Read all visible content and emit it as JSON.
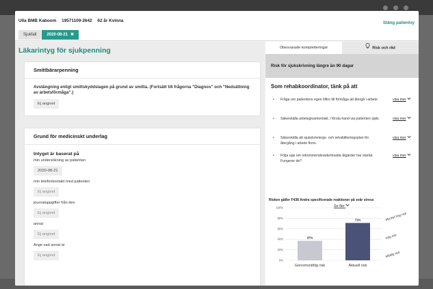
{
  "patient": {
    "name": "Ulla BMB Kaboom",
    "id": "19571109-2642",
    "age_gender": "62 år Kvinna"
  },
  "close_label": "Stäng patientvy",
  "tabs": [
    {
      "label": "Sjukfall"
    },
    {
      "label": "2020-08-21",
      "close": "✖"
    }
  ],
  "page_title": "Läkarintyg för sjukpenning",
  "smitt": {
    "heading": "Smittbärarpenning",
    "description": "Avstängning enligt smittskyddslagen på grund av smitta. (Fortsätt till frågorna \"Diagnos\" och \"Nedsättning av arbetsförmåga\".)",
    "value": "Ej angivet"
  },
  "grund": {
    "heading": "Grund för medicinskt underlag",
    "subheading": "Intyget är baserat på",
    "fields": [
      {
        "label": "min undersökning av patienten",
        "value": "2020-08-21",
        "empty": false
      },
      {
        "label": "min telefonkontakt med patienten",
        "value": "Ej angivet",
        "empty": true
      },
      {
        "label": "journaluppgifter från den",
        "value": "Ej angivet",
        "empty": true
      },
      {
        "label": "annat",
        "value": "Ej angivet",
        "empty": true
      },
      {
        "label": "Ange vad annat är",
        "value": "Ej angivet",
        "empty": true
      }
    ]
  },
  "right_tabs": {
    "complements": "Obesvarade kompletteringar",
    "risk": "Risk och råd"
  },
  "risk_banner": "Risk för sjukskrivning längre än 90 dagar",
  "rehab_title": "Som rehabkoordinator, tänk på att",
  "recommendations": [
    {
      "text": "Fråga om patientens egen tilltro till förmåga att återgå i arbete",
      "more": "visa mer"
    },
    {
      "text": "Säkerställa arbetsgivarkontakt, i första hand via patienten själv.",
      "more": "visa mer"
    },
    {
      "text": "Säkerställa att sjukskrivnings- och rehabiliteringsplan för återgång i arbete finns.",
      "more": "visa mer"
    },
    {
      "text": "Följa upp om rekommenderade/insatta åtgärder har startat. Fungerar de?",
      "more": "visa mer"
    }
  ],
  "see_more": "Se fler",
  "chart_data": {
    "type": "bar",
    "title": "Risken gäller F438 Andra specificerade reaktioner på svår stress",
    "categories": [
      "Genomsnittlig risk",
      "Aktuell risk"
    ],
    "values": [
      37,
      71
    ],
    "value_labels": [
      "37%",
      "71%"
    ],
    "ylim": [
      0,
      100
    ],
    "yticks": [
      "0%",
      "20%",
      "40%",
      "60%",
      "80%",
      "100%"
    ],
    "bar_colors": [
      "#c7c8d0",
      "#4a5377"
    ],
    "zones": [
      "Måttlig risk",
      "Hög risk",
      "Mycket hög risk"
    ],
    "grid": true
  }
}
